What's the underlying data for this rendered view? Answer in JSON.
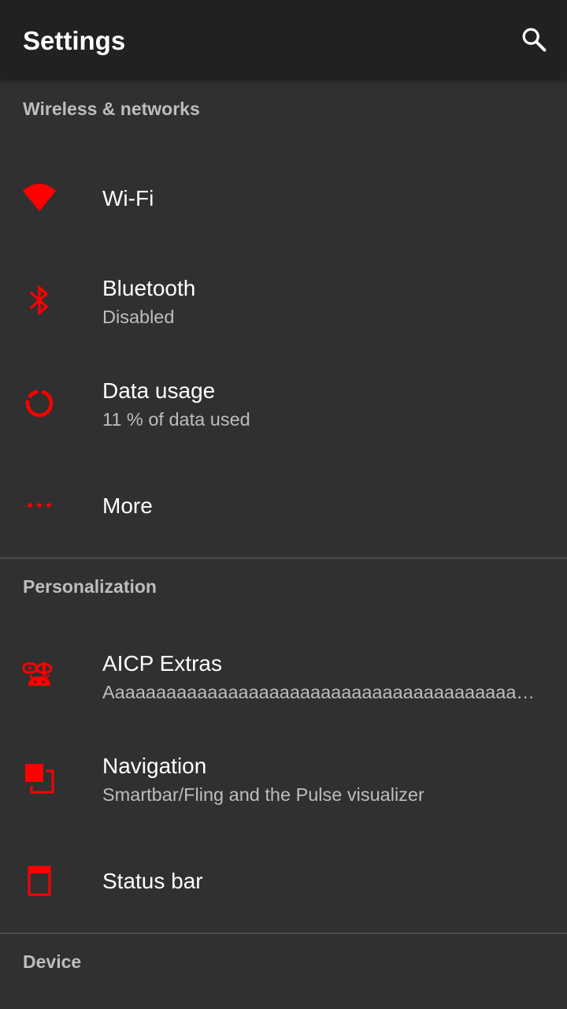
{
  "appbar": {
    "title": "Settings",
    "search_icon": "search-icon"
  },
  "colors": {
    "accent": "#ff0000",
    "background": "#303030",
    "appbar": "#212121"
  },
  "sections": {
    "wireless": {
      "header": "Wireless & networks",
      "wifi": {
        "title": "Wi-Fi",
        "icon": "wifi-icon"
      },
      "bluetooth": {
        "title": "Bluetooth",
        "summary": "Disabled",
        "icon": "bluetooth-icon"
      },
      "data_usage": {
        "title": "Data usage",
        "summary": "11 % of data used",
        "icon": "data-usage-icon"
      },
      "more": {
        "title": "More",
        "icon": "more-dots-icon"
      }
    },
    "personalization": {
      "header": "Personalization",
      "aicp_extras": {
        "title": "AICP Extras",
        "summary": "Aaaaaaaaaaaaaaaaaaaaaaaaaaaaaaaaaaaaaaaaaaaaaaaaaaaaaaaa",
        "icon": "aicp-icon"
      },
      "navigation": {
        "title": "Navigation",
        "summary": "Smartbar/Fling and the Pulse visualizer",
        "icon": "navigation-icon"
      },
      "status_bar": {
        "title": "Status bar",
        "icon": "status-bar-icon"
      }
    },
    "device": {
      "header": "Device"
    }
  }
}
